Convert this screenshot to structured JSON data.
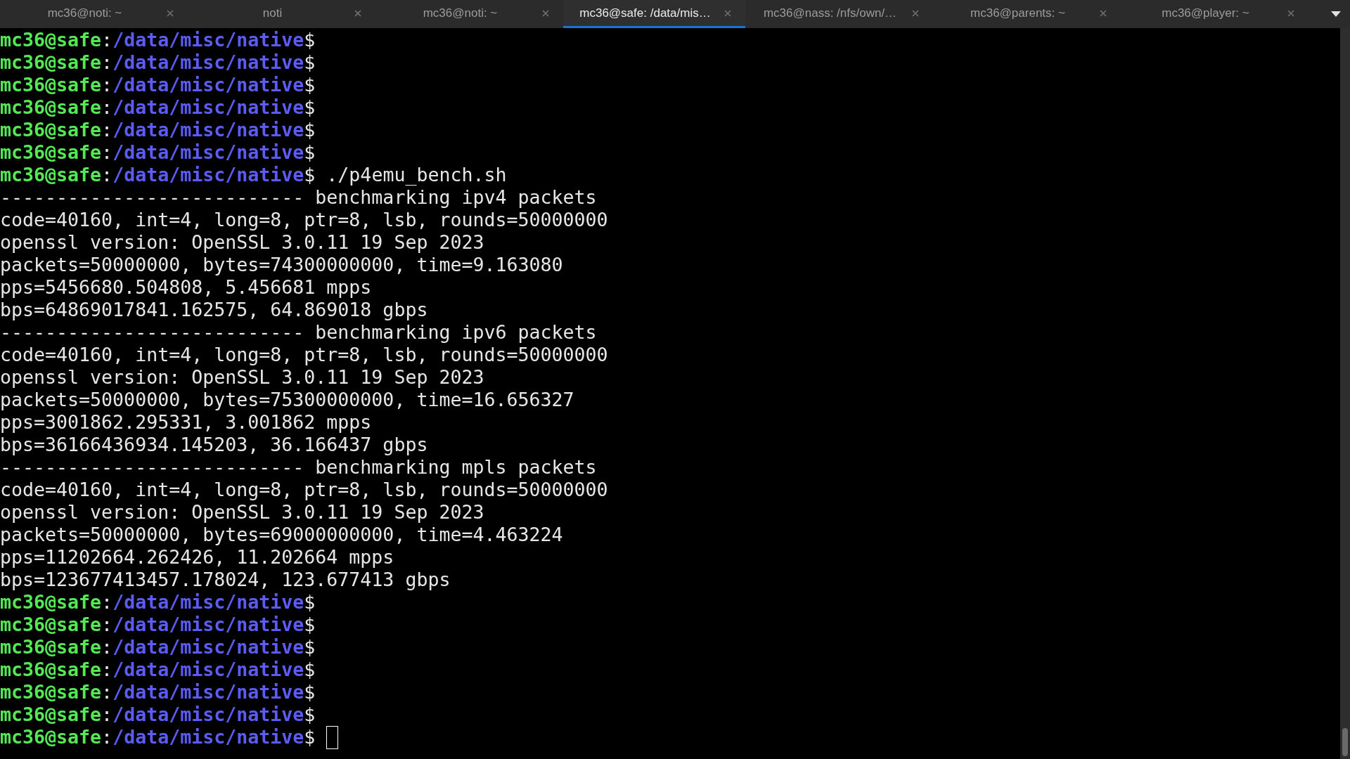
{
  "tabs": [
    {
      "label": "mc36@noti: ~",
      "selected": false
    },
    {
      "label": "noti",
      "selected": false
    },
    {
      "label": "mc36@noti: ~",
      "selected": false
    },
    {
      "label": "mc36@safe: /data/mis…",
      "selected": true
    },
    {
      "label": "mc36@nass: /nfs/own/…",
      "selected": false
    },
    {
      "label": "mc36@parents: ~",
      "selected": false
    },
    {
      "label": "mc36@player: ~",
      "selected": false
    }
  ],
  "terminal": {
    "lines": [
      {
        "kind": "prompt",
        "user_host": "mc36@safe",
        "separator": ":",
        "path": "/data/misc/native",
        "symbol": "$"
      },
      {
        "kind": "prompt",
        "user_host": "mc36@safe",
        "separator": ":",
        "path": "/data/misc/native",
        "symbol": "$"
      },
      {
        "kind": "prompt",
        "user_host": "mc36@safe",
        "separator": ":",
        "path": "/data/misc/native",
        "symbol": "$"
      },
      {
        "kind": "prompt",
        "user_host": "mc36@safe",
        "separator": ":",
        "path": "/data/misc/native",
        "symbol": "$"
      },
      {
        "kind": "prompt",
        "user_host": "mc36@safe",
        "separator": ":",
        "path": "/data/misc/native",
        "symbol": "$"
      },
      {
        "kind": "prompt",
        "user_host": "mc36@safe",
        "separator": ":",
        "path": "/data/misc/native",
        "symbol": "$"
      },
      {
        "kind": "prompt",
        "user_host": "mc36@safe",
        "separator": ":",
        "path": "/data/misc/native",
        "symbol": "$",
        "command": "./p4emu_bench.sh"
      },
      {
        "kind": "output",
        "text": "--------------------------- benchmarking ipv4 packets"
      },
      {
        "kind": "output",
        "text": "code=40160, int=4, long=8, ptr=8, lsb, rounds=50000000"
      },
      {
        "kind": "output",
        "text": "openssl version: OpenSSL 3.0.11 19 Sep 2023"
      },
      {
        "kind": "output",
        "text": "packets=50000000, bytes=74300000000, time=9.163080"
      },
      {
        "kind": "output",
        "text": "pps=5456680.504808, 5.456681 mpps"
      },
      {
        "kind": "output",
        "text": "bps=64869017841.162575, 64.869018 gbps"
      },
      {
        "kind": "output",
        "text": "--------------------------- benchmarking ipv6 packets"
      },
      {
        "kind": "output",
        "text": "code=40160, int=4, long=8, ptr=8, lsb, rounds=50000000"
      },
      {
        "kind": "output",
        "text": "openssl version: OpenSSL 3.0.11 19 Sep 2023"
      },
      {
        "kind": "output",
        "text": "packets=50000000, bytes=75300000000, time=16.656327"
      },
      {
        "kind": "output",
        "text": "pps=3001862.295331, 3.001862 mpps"
      },
      {
        "kind": "output",
        "text": "bps=36166436934.145203, 36.166437 gbps"
      },
      {
        "kind": "output",
        "text": "--------------------------- benchmarking mpls packets"
      },
      {
        "kind": "output",
        "text": "code=40160, int=4, long=8, ptr=8, lsb, rounds=50000000"
      },
      {
        "kind": "output",
        "text": "openssl version: OpenSSL 3.0.11 19 Sep 2023"
      },
      {
        "kind": "output",
        "text": "packets=50000000, bytes=69000000000, time=4.463224"
      },
      {
        "kind": "output",
        "text": "pps=11202664.262426, 11.202664 mpps"
      },
      {
        "kind": "output",
        "text": "bps=123677413457.178024, 123.677413 gbps"
      },
      {
        "kind": "prompt",
        "user_host": "mc36@safe",
        "separator": ":",
        "path": "/data/misc/native",
        "symbol": "$"
      },
      {
        "kind": "prompt",
        "user_host": "mc36@safe",
        "separator": ":",
        "path": "/data/misc/native",
        "symbol": "$"
      },
      {
        "kind": "prompt",
        "user_host": "mc36@safe",
        "separator": ":",
        "path": "/data/misc/native",
        "symbol": "$"
      },
      {
        "kind": "prompt",
        "user_host": "mc36@safe",
        "separator": ":",
        "path": "/data/misc/native",
        "symbol": "$"
      },
      {
        "kind": "prompt",
        "user_host": "mc36@safe",
        "separator": ":",
        "path": "/data/misc/native",
        "symbol": "$"
      },
      {
        "kind": "prompt",
        "user_host": "mc36@safe",
        "separator": ":",
        "path": "/data/misc/native",
        "symbol": "$"
      },
      {
        "kind": "prompt",
        "user_host": "mc36@safe",
        "separator": ":",
        "path": "/data/misc/native",
        "symbol": "$"
      }
    ]
  }
}
